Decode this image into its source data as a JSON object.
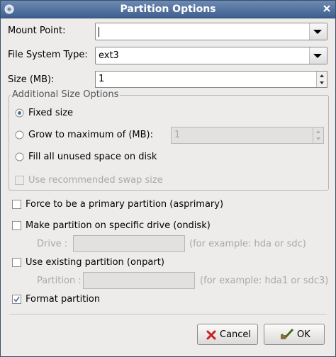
{
  "window": {
    "title": "Partition Options"
  },
  "mount_point": {
    "label": "Mount Point:",
    "value": ""
  },
  "fs_type": {
    "label": "File System Type:",
    "value": "ext3"
  },
  "size": {
    "label": "Size (MB):",
    "value": "1"
  },
  "additional": {
    "legend": "Additional Size Options",
    "fixed": {
      "label": "Fixed size",
      "selected": true
    },
    "grow": {
      "label": "Grow to maximum of (MB):",
      "value": "1"
    },
    "fill": {
      "label": "Fill all unused space on disk"
    },
    "swap": {
      "label": "Use recommended swap size",
      "checked": false
    }
  },
  "primary": {
    "label": "Force to be a primary partition (asprimary)",
    "checked": false
  },
  "ondisk": {
    "label": "Make partition on specific drive (ondisk)",
    "checked": false,
    "drive_label": "Drive :",
    "drive_hint": "(for example: hda or sdc)",
    "drive_value": ""
  },
  "onpart": {
    "label": "Use existing partition (onpart)",
    "checked": false,
    "part_label": "Partition :",
    "part_hint": "(for example: hda1 or sdc3)",
    "part_value": ""
  },
  "format": {
    "label": "Format partition",
    "checked": true
  },
  "buttons": {
    "cancel": "Cancel",
    "ok": "OK"
  },
  "icons": {
    "app": "app-menu-icon",
    "close": "close-icon",
    "dropdown": "chevron-down-icon",
    "spin": "spin-arrows-icon",
    "cancel": "cancel-x-icon",
    "ok": "ok-check-icon"
  },
  "colors": {
    "titlebar": "#4d6d9c",
    "background": "#edeceb",
    "cancel_icon": "#cc1f1f",
    "ok_icon": "#4a6a1c"
  }
}
